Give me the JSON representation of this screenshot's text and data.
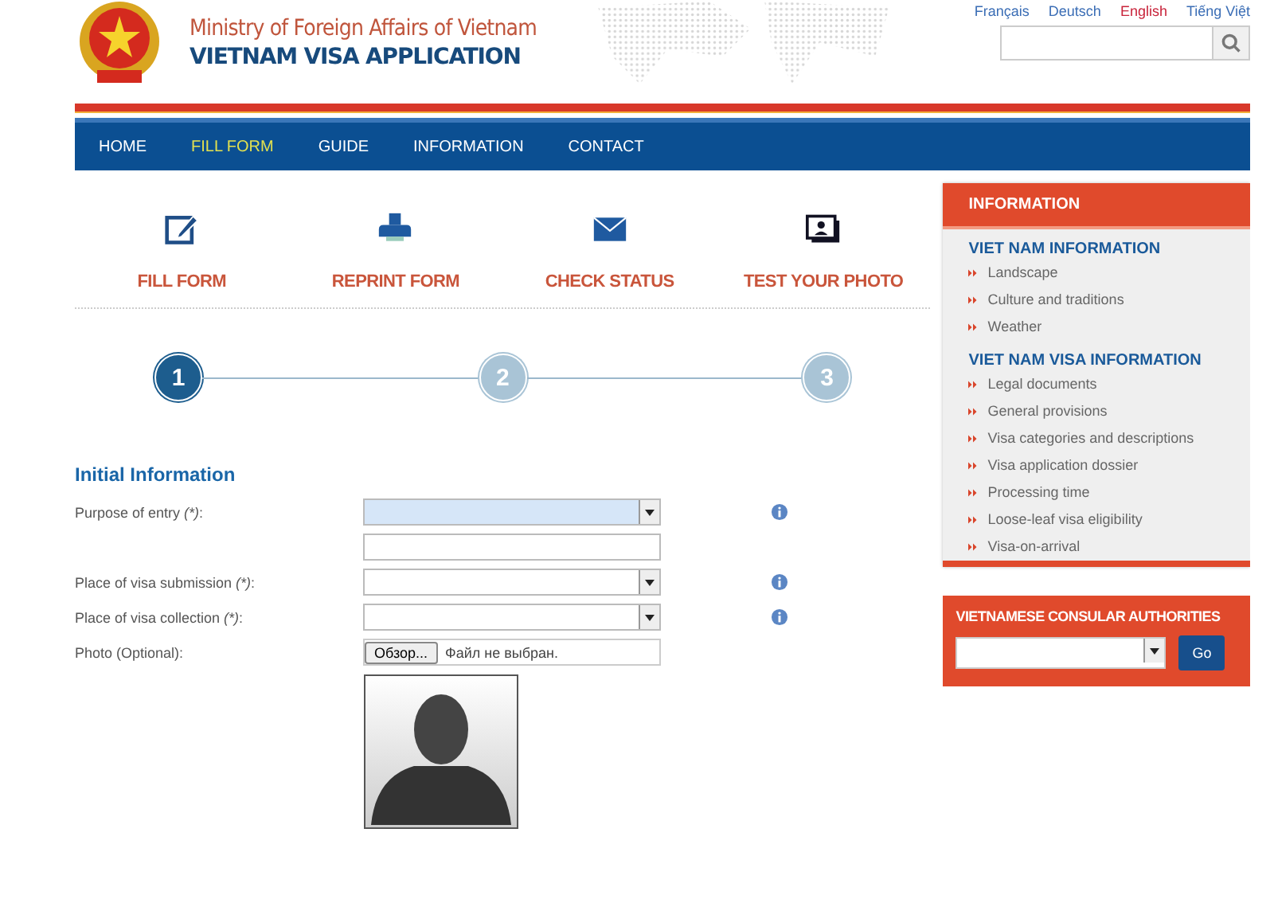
{
  "header": {
    "ministry": "Ministry of Foreign Affairs of Vietnam",
    "title": "VIETNAM VISA APPLICATION"
  },
  "languages": [
    {
      "label": "Français",
      "selected": false
    },
    {
      "label": "Deutsch",
      "selected": false
    },
    {
      "label": "English",
      "selected": true
    },
    {
      "label": "Tiếng Việt",
      "selected": false
    }
  ],
  "nav": [
    {
      "label": "HOME",
      "selected": false
    },
    {
      "label": "FILL FORM",
      "selected": true
    },
    {
      "label": "GUIDE",
      "selected": false
    },
    {
      "label": "INFORMATION",
      "selected": false
    },
    {
      "label": "CONTACT",
      "selected": false
    }
  ],
  "services": [
    {
      "kind": "edit",
      "label": "FILL FORM"
    },
    {
      "kind": "print",
      "label": "REPRINT FORM"
    },
    {
      "kind": "mail",
      "label": "CHECK STATUS"
    },
    {
      "kind": "photo",
      "label": "TEST YOUR PHOTO"
    }
  ],
  "steps": [
    {
      "label": "1",
      "selected": true
    },
    {
      "label": "2",
      "selected": false
    },
    {
      "label": "3",
      "selected": false
    }
  ],
  "form": {
    "title": "Initial Information",
    "fields": [
      {
        "kind": "select",
        "label": "Purpose of entry",
        "required_mark": "(*)",
        "suffix": ":",
        "info": true,
        "focused": true
      },
      {
        "kind": "text",
        "info": false,
        "focused": false
      },
      {
        "kind": "select",
        "label": "Place of visa submission",
        "required_mark": "(*)",
        "suffix": ":",
        "info": true,
        "focused": false
      },
      {
        "kind": "select",
        "label": "Place of visa collection",
        "required_mark": "(*)",
        "suffix": ":",
        "info": true,
        "focused": false
      },
      {
        "kind": "file",
        "label": "Photo (Optional):",
        "button": "Обзор...",
        "value": "Файл не выбран.",
        "info": false,
        "focused": false
      }
    ]
  },
  "sidebar": {
    "title": "INFORMATION",
    "sections": [
      {
        "heading": "VIET NAM INFORMATION",
        "items": [
          "Landscape",
          "Culture and traditions",
          "Weather"
        ]
      },
      {
        "heading": "VIET NAM VISA INFORMATION",
        "items": [
          "Legal documents",
          "General provisions",
          "Visa categories and descriptions",
          "Visa application dossier",
          "Processing time",
          "Loose-leaf visa eligibility",
          "Visa-on-arrival"
        ]
      }
    ]
  },
  "consular": {
    "title": "VIETNAMESE CONSULAR AUTHORITIES",
    "button": "Go"
  }
}
